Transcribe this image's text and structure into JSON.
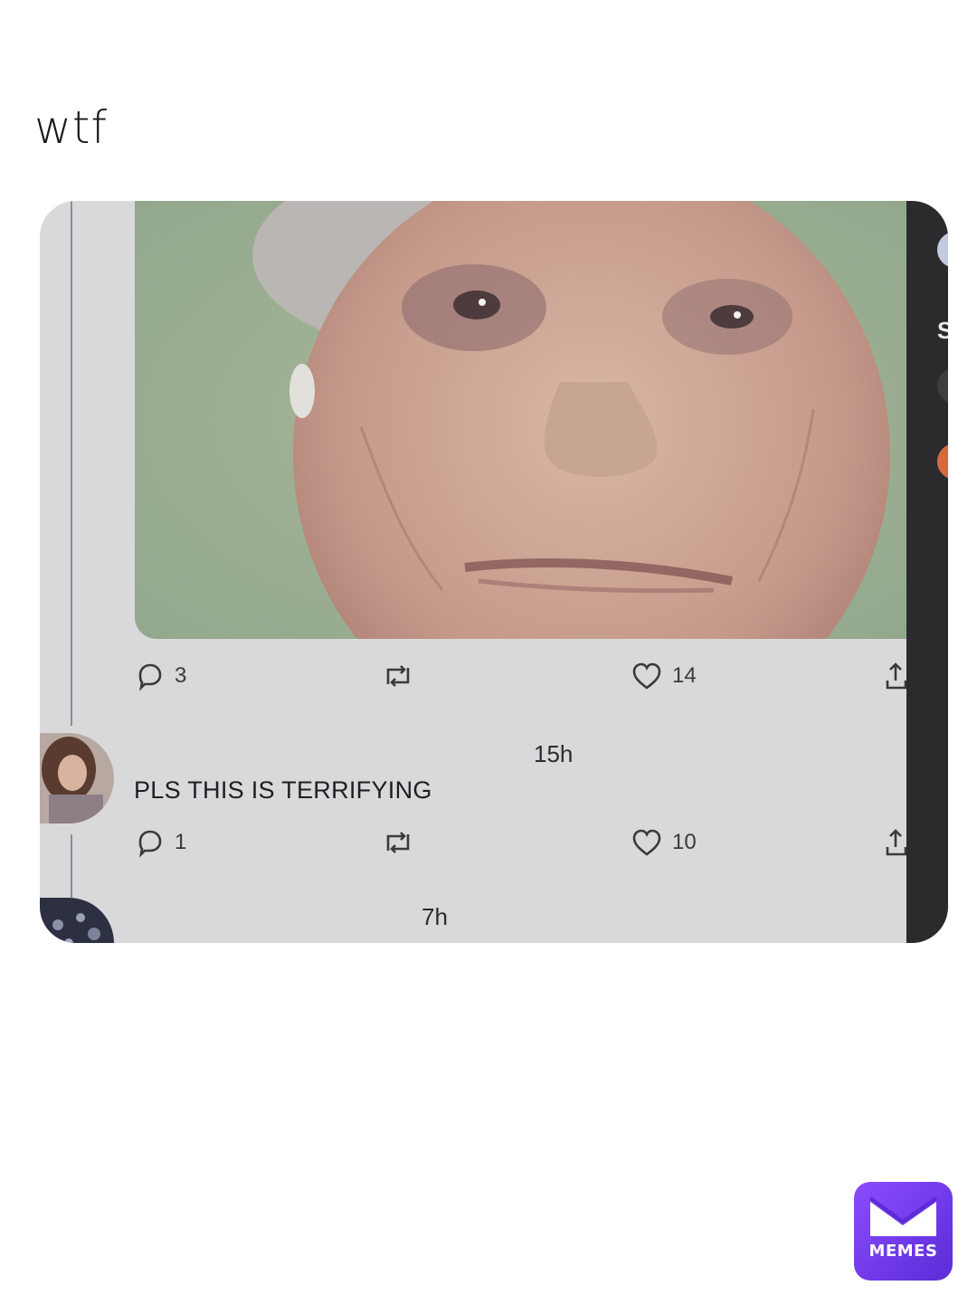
{
  "caption": "wtf",
  "tweet_actions": {
    "replies": "3",
    "likes": "14"
  },
  "reply1": {
    "time": "15h",
    "text": "PLS THIS IS TERRIFYING",
    "replies": "1",
    "likes": "10"
  },
  "reply2": {
    "time": "7h"
  },
  "sidebar_letter": "S",
  "watermark": {
    "label": "MEMES"
  },
  "colors": {
    "accent": "#7b3fff",
    "panel": "#d9d9dc",
    "dark_strip": "#2b2b2d"
  },
  "icons": [
    "reply-icon",
    "retweet-icon",
    "like-icon",
    "share-icon",
    "mail-icon"
  ]
}
